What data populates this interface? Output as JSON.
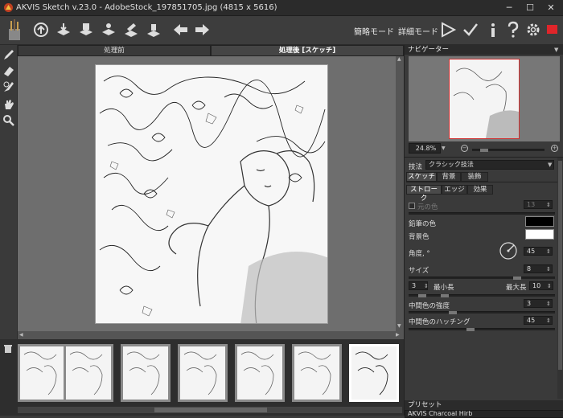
{
  "window": {
    "title": "AKVIS Sketch v.23.0 - AdobeStock_197851705.jpg (4815 x 5616)",
    "minimize": "─",
    "maximize": "☐",
    "close": "✕"
  },
  "toolbar": {
    "mode_express": "簡略モード",
    "mode_advanced": "詳細モード"
  },
  "tabs": {
    "before": "処理前",
    "after": "処理後 [スケッチ]"
  },
  "navigator": {
    "title": "ナビゲーター",
    "zoom": "24.8%"
  },
  "settings": {
    "technique_label": "技法",
    "technique_value": "クラシック技法",
    "main_tabs": [
      "スケッチ",
      "背景",
      "装飾"
    ],
    "sub_tabs": [
      "ストローク",
      "エッジ",
      "効果"
    ],
    "original_color_label": "元の色",
    "original_color_value": "13",
    "pencil_color_label": "鉛筆の色",
    "bg_color_label": "背景色",
    "angle_label": "角度, °",
    "angle_value": "45",
    "size_label": "サイズ",
    "size_value": "8",
    "min_length_value": "3",
    "min_length_label": "最小長",
    "max_length_label": "最大長",
    "max_length_value": "10",
    "midtone_intensity_label": "中間色の強度",
    "midtone_intensity_value": "3",
    "midtone_hatching_label": "中間色のハッチング",
    "midtone_hatching_value": "45"
  },
  "presets": {
    "title": "プリセット",
    "current": "AKVIS Charcoal Hirb"
  },
  "colors": {
    "pencil": "#000000",
    "background": "#ffffff",
    "close_accent": "#e0252a",
    "nav_frame": "#d03030"
  },
  "filmstrip": {
    "count": 7,
    "selected_index": 6
  }
}
